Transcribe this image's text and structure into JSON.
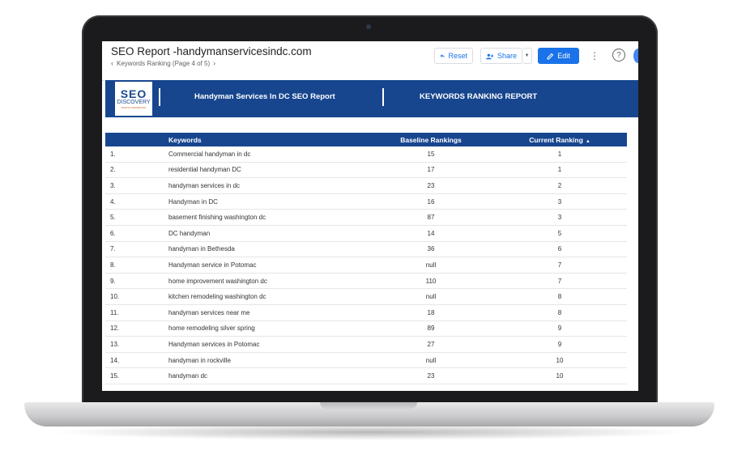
{
  "report": {
    "title": "SEO Report -handymanservicesindc.com",
    "page_nav": "Keywords Ranking (Page 4 of 5)"
  },
  "toolbar": {
    "reset_label": "Reset",
    "share_label": "Share",
    "edit_label": "Edit"
  },
  "icons": {
    "reset": "reset-icon",
    "share": "person-add-icon",
    "edit": "pencil-icon",
    "more": "more-vert-icon",
    "help": "help-icon"
  },
  "banner": {
    "logo_top": "SEO",
    "logo_mid": "DISCOVERY",
    "logo_tag": "DIGITAL MARKETING",
    "left_title": "Handyman Services In DC SEO Report",
    "right_title": "KEYWORDS RANKING REPORT"
  },
  "colors": {
    "banner": "#17468f",
    "accent": "#1a73e8"
  },
  "table": {
    "headers": [
      "",
      "Keywords",
      "Baseline Rankings",
      "Current Ranking"
    ],
    "sort_indicator": "▲",
    "rows": [
      {
        "num": "1.",
        "keyword": "Commercial handyman in dc",
        "baseline": "15",
        "current": "1"
      },
      {
        "num": "2.",
        "keyword": "residential handyman DC",
        "baseline": "17",
        "current": "1"
      },
      {
        "num": "3.",
        "keyword": "handyman services in dc",
        "baseline": "23",
        "current": "2"
      },
      {
        "num": "4.",
        "keyword": "Handyman in DC",
        "baseline": "16",
        "current": "3"
      },
      {
        "num": "5.",
        "keyword": "basement finishing washington dc",
        "baseline": "87",
        "current": "3"
      },
      {
        "num": "6.",
        "keyword": "DC handyman",
        "baseline": "14",
        "current": "5"
      },
      {
        "num": "7.",
        "keyword": "handyman in Bethesda",
        "baseline": "36",
        "current": "6"
      },
      {
        "num": "8.",
        "keyword": "Handyman service in Potomac",
        "baseline": "null",
        "current": "7"
      },
      {
        "num": "9.",
        "keyword": "home improvement washington dc",
        "baseline": "110",
        "current": "7"
      },
      {
        "num": "10.",
        "keyword": "kitchen remodeling washington dc",
        "baseline": "null",
        "current": "8"
      },
      {
        "num": "11.",
        "keyword": "handyman services near me",
        "baseline": "18",
        "current": "8"
      },
      {
        "num": "12.",
        "keyword": "home remodeling silver spring",
        "baseline": "89",
        "current": "9"
      },
      {
        "num": "13.",
        "keyword": "Handyman services in Potomac",
        "baseline": "27",
        "current": "9"
      },
      {
        "num": "14.",
        "keyword": "handyman in rockville",
        "baseline": "null",
        "current": "10"
      },
      {
        "num": "15.",
        "keyword": "handyman dc",
        "baseline": "23",
        "current": "10"
      }
    ]
  }
}
